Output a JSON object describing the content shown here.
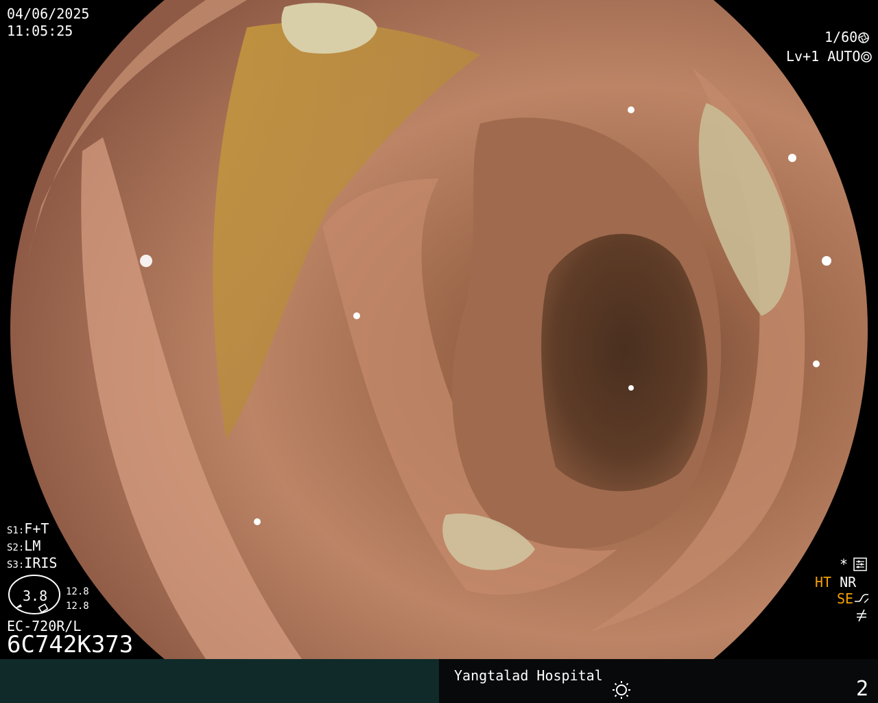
{
  "overlay": {
    "date": "04/06/2025",
    "time": "11:05:25",
    "shutter": "1/60",
    "level": "Lv+1",
    "auto": "AUTO",
    "s1_label": "S1:",
    "s1_value": "F+T",
    "s2_label": "S2:",
    "s2_value": "LM",
    "s3_label": "S3:",
    "s3_value": "IRIS",
    "gauge_value": "3.8",
    "gauge_top": "12.8",
    "gauge_bottom": "12.8",
    "scope_model": "EC-720R/L",
    "serial": "6C742K373",
    "mode_star": "*",
    "ht": "HT",
    "nr": "NR",
    "se": "SE",
    "hospital": "Yangtalad Hospital",
    "image_number": "2"
  },
  "icons": {
    "shutter": "aperture-icon",
    "auto": "iris-icon",
    "settings": "settings-icon",
    "se": "curve-icon",
    "filter": "not-equal-icon",
    "light": "sun-icon"
  },
  "colors": {
    "mucosa": "#b77a5a",
    "lumen": "#5a3a26",
    "bile": "#b08a3a",
    "footer_left": "#0f2a29",
    "status_orange": "#f5a000"
  }
}
